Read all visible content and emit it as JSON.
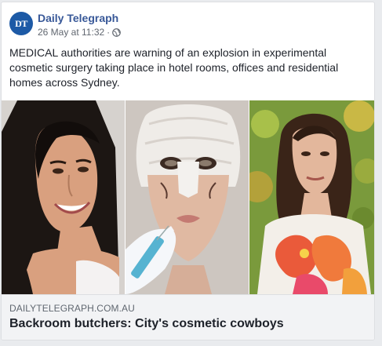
{
  "post": {
    "avatar_text": "DT",
    "page_name": "Daily Telegraph",
    "timestamp": "26 May at 11:32",
    "separator": "·",
    "privacy_icon": "globe-icon",
    "message": "MEDICAL authorities are warning of an explosion in experimental cosmetic surgery taking place in hotel rooms, offices and residential homes across Sydney."
  },
  "link_preview": {
    "domain": "DAILYTELEGRAPH.COM.AU",
    "headline": "Backroom butchers: City's cosmetic cowboys"
  },
  "colors": {
    "brand_blue": "#385898",
    "avatar_bg": "#1d5aa6",
    "footer_bg": "#f2f3f5",
    "page_bg": "#e9ebee"
  }
}
